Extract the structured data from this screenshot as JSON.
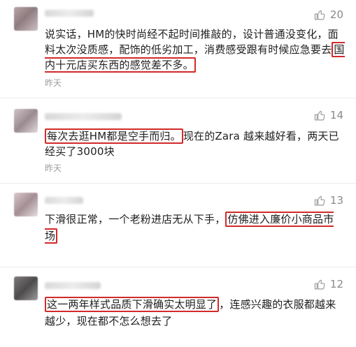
{
  "comments": [
    {
      "likes": "20",
      "pre": "说实话，HM的快时尚经不起时间推敲的，设计普通没变化，面料太次没质感，配饰的低劣加工，消费感受跟有时候应急要去",
      "highlight": "国内十元店买东西的感觉差不多。",
      "post": "",
      "time": "昨天"
    },
    {
      "likes": "14",
      "pre": "",
      "highlight": "每次去逛HM都是空手而归。",
      "post": "现在的Zara 越来越好看，两天已经买了3000块",
      "time": "昨天"
    },
    {
      "likes": "13",
      "pre": "下滑很正常，一个老粉进店无从下手，",
      "highlight": "仿佛进入廉价小商品市场",
      "post": "",
      "time": ""
    },
    {
      "likes": "12",
      "pre": "",
      "highlight": "这一两年样式品质下滑确实太明显了",
      "post": "，连感兴趣的衣服都越来越少，现在都不怎么想去了",
      "time": ""
    }
  ],
  "colors": {
    "highlight_border": "#d22a2a",
    "muted": "#9d9d9d"
  },
  "icons": {
    "like": "thumbs-up-icon"
  }
}
